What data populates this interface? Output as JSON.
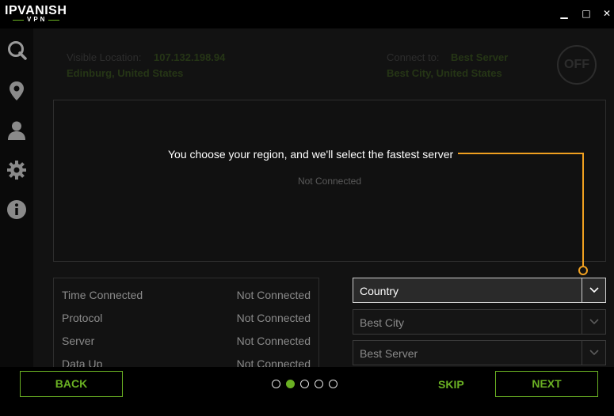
{
  "app": {
    "logo_main": "IPVANISH",
    "logo_sub": "VPN",
    "accent_color": "#6ab023",
    "tip_color": "#f0a020"
  },
  "window_controls": {
    "minimize": "▁",
    "maximize": "□",
    "close": "✕"
  },
  "sidebar": {
    "items": [
      {
        "icon": "search-icon"
      },
      {
        "icon": "location-pin-icon"
      },
      {
        "icon": "user-icon"
      },
      {
        "icon": "gear-icon"
      },
      {
        "icon": "info-icon"
      }
    ]
  },
  "status": {
    "visible_location_label": "Visible Location:",
    "ip": "107.132.198.94",
    "city": "Edinburg, United States",
    "connect_to_label": "Connect to:",
    "connect_server": "Best Server",
    "connect_city": "Best City, United States",
    "power_label": "OFF"
  },
  "map": {
    "status": "Not Connected"
  },
  "tutorial": {
    "tip": "You choose your region, and we'll select the fastest server",
    "current_step": 2,
    "total_steps": 5
  },
  "stats": [
    {
      "label": "Time Connected",
      "value": "Not Connected"
    },
    {
      "label": "Protocol",
      "value": "Not Connected"
    },
    {
      "label": "Server",
      "value": "Not Connected"
    },
    {
      "label": "Data Up",
      "value": "Not Connected"
    }
  ],
  "selectors": {
    "country": "Country",
    "city": "Best City",
    "server": "Best Server"
  },
  "nav": {
    "back": "BACK",
    "skip": "SKIP",
    "next": "NEXT"
  }
}
